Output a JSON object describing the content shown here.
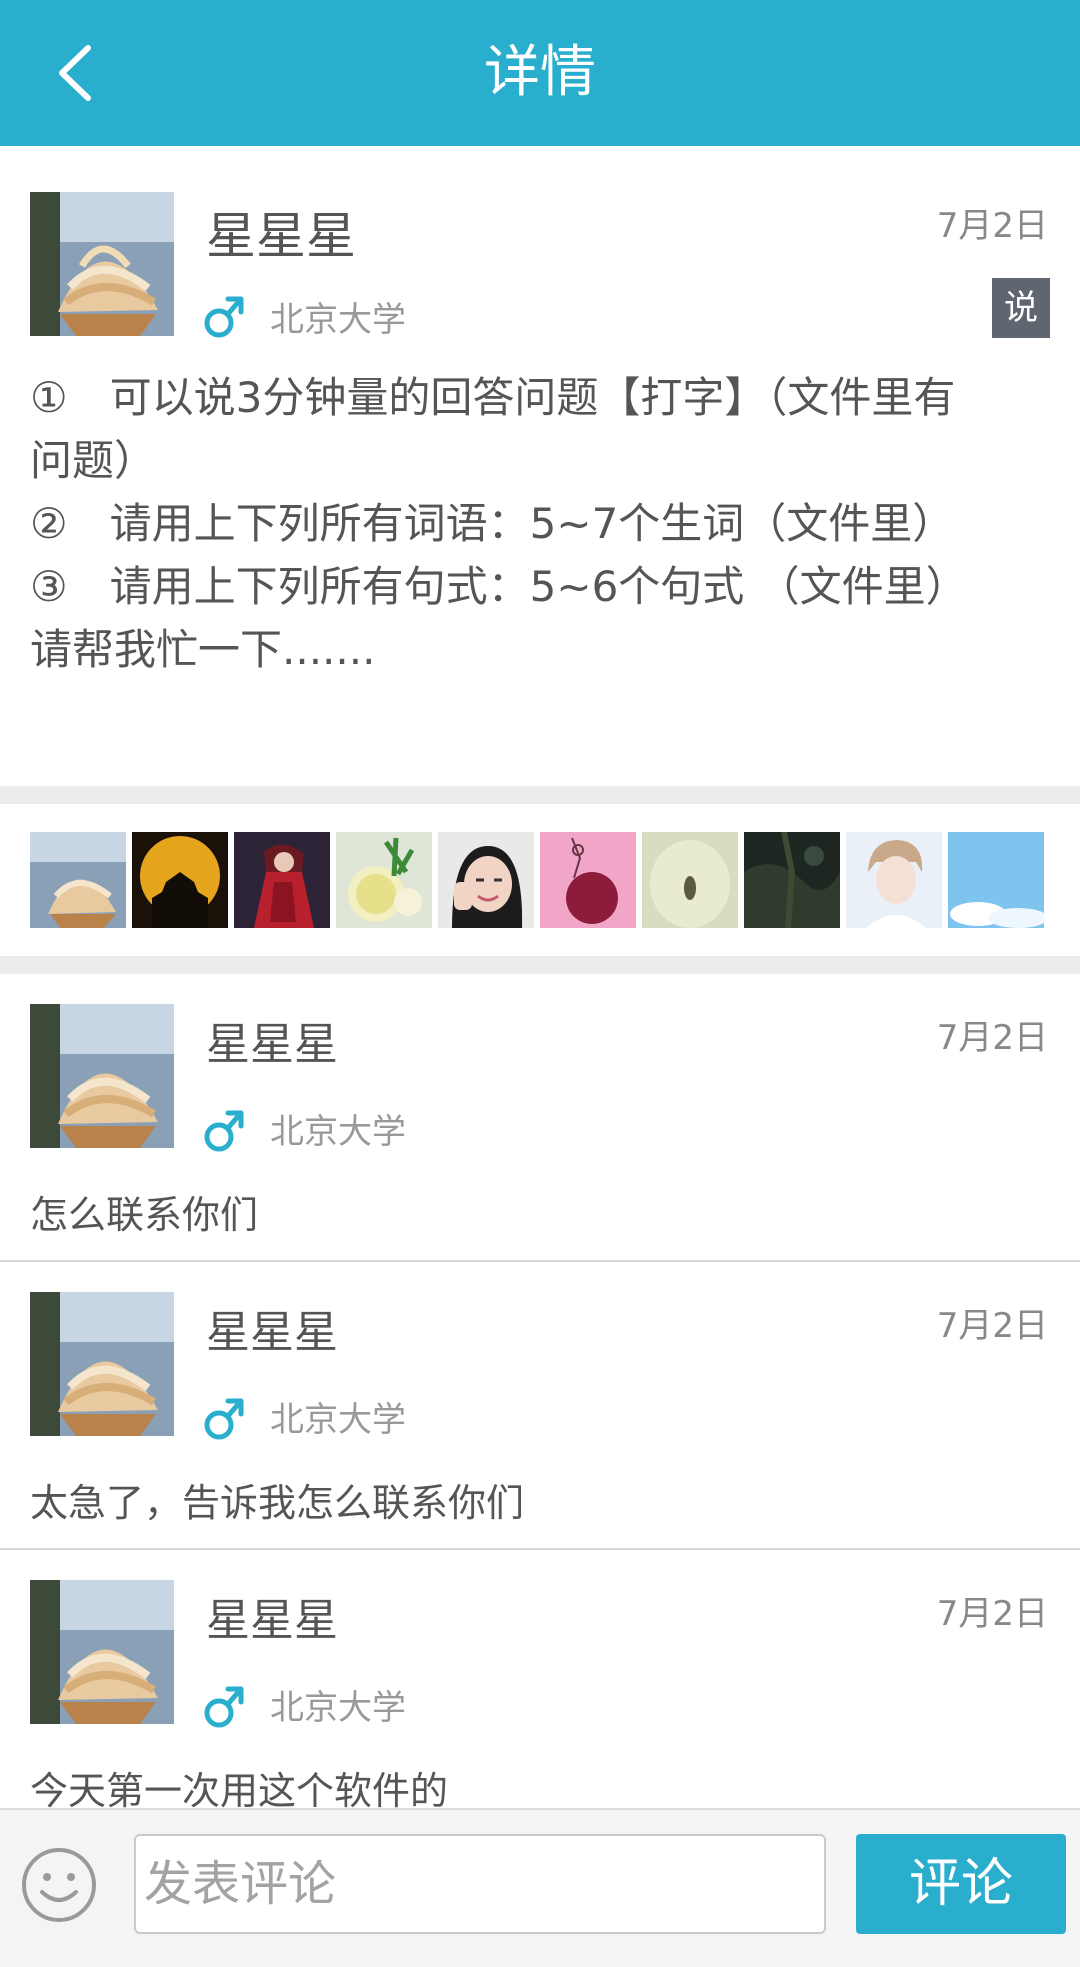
{
  "header": {
    "title": "详情",
    "back_icon": "chevron-left-icon",
    "background": "#29aecd"
  },
  "post": {
    "author": "星星星",
    "date": "7月2日",
    "gender_icon": "male-symbol-icon",
    "school": "北京大学",
    "tag": "说",
    "lines": [
      "①　可以说3分钟量的回答问题【打字】（文件里有",
      "问题）",
      "②　请用上下列所有词语：5~7个生词（文件里）",
      "③　请用上下列所有句式：5~6个句式 （文件里）",
      "请帮我忙一下......."
    ]
  },
  "likes": [
    "icecream",
    "moon-castle",
    "red-robe-figure",
    "lemon-drink",
    "girl-selfie",
    "pink-rose-sketch",
    "pale-jar",
    "dark-forest",
    "young-man-portrait",
    "blue-sky"
  ],
  "comments": [
    {
      "author": "星星星",
      "date": "7月2日",
      "school": "北京大学",
      "text": "怎么联系你们"
    },
    {
      "author": "星星星",
      "date": "7月2日",
      "school": "北京大学",
      "text": "太急了，告诉我怎么联系你们"
    },
    {
      "author": "星星星",
      "date": "7月2日",
      "school": "北京大学",
      "text": "今天第一次用这个软件的"
    }
  ],
  "bottom_bar": {
    "emoji_icon": "smiley-face-icon",
    "input_placeholder": "发表评论",
    "send_label": "评论",
    "accent": "#29aecd"
  }
}
